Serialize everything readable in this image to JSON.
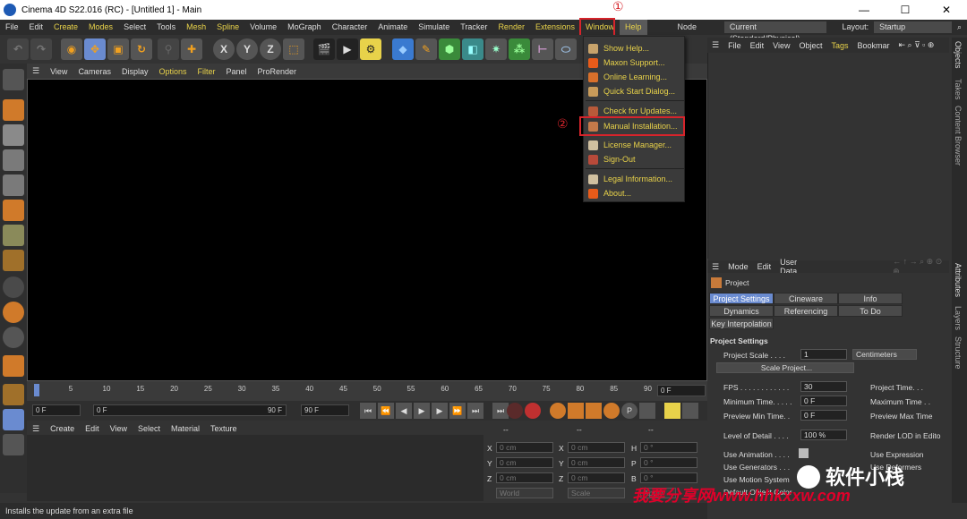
{
  "window": {
    "title": "Cinema 4D S22.016 (RC) - [Untitled 1] - Main",
    "minimize": "—",
    "maximize": "☐",
    "close": "✕"
  },
  "menubar": {
    "items": [
      "File",
      "Edit",
      "Create",
      "Modes",
      "Select",
      "Tools",
      "Mesh",
      "Spline",
      "Volume",
      "MoGraph",
      "Character",
      "Animate",
      "Simulate",
      "Tracker",
      "Render",
      "Extensions",
      "Window"
    ],
    "help": "Help",
    "node_space_label": "Node Space:",
    "node_space_value": "Current (Standard/Physical)",
    "layout_label": "Layout:",
    "layout_value": "Startup"
  },
  "annotations": {
    "step1": "①",
    "step2": "②"
  },
  "help_menu": {
    "items": [
      {
        "label": "Show Help...",
        "icon": "help-book-icon",
        "color": "#c8a36b"
      },
      {
        "label": "Maxon Support...",
        "icon": "maxon-logo-icon",
        "color": "#e85b1a"
      },
      {
        "label": "Online Learning...",
        "icon": "learning-icon",
        "color": "#d9702b"
      },
      {
        "label": "Quick Start Dialog...",
        "icon": "quick-start-icon",
        "color": "#c89b5a"
      },
      {
        "label": "Check for Updates...",
        "icon": "update-icon",
        "color": "#b85a3a"
      },
      {
        "label": "Manual Installation...",
        "icon": "manual-install-icon",
        "color": "#c47a4a"
      },
      {
        "label": "License Manager...",
        "icon": "license-icon",
        "color": "#d0c0a0"
      },
      {
        "label": "Sign-Out",
        "icon": "sign-out-icon",
        "color": "#b84a3a"
      },
      {
        "label": "Legal Information...",
        "icon": "legal-icon",
        "color": "#d0c0a0"
      },
      {
        "label": "About...",
        "icon": "about-icon",
        "color": "#e85b1a"
      }
    ]
  },
  "viewport_menu": [
    "View",
    "Cameras",
    "Display",
    "Options",
    "Filter",
    "Panel",
    "ProRender"
  ],
  "timeline": {
    "ticks": [
      "0",
      "5",
      "10",
      "15",
      "20",
      "25",
      "30",
      "35",
      "40",
      "45",
      "50",
      "55",
      "60",
      "65",
      "70",
      "75",
      "80",
      "85",
      "90"
    ],
    "current_frame": "0 F",
    "start": "0 F",
    "preview_start": "0 F",
    "preview_end": "90 F",
    "end": "90 F"
  },
  "material_menu": [
    "Create",
    "Edit",
    "View",
    "Select",
    "Material",
    "Texture"
  ],
  "coordinates": {
    "header": "--",
    "header2": "--",
    "header3": "--",
    "rows": [
      {
        "a": "X",
        "av": "0 cm",
        "b": "X",
        "bv": "0 cm",
        "c": "H",
        "cv": "0 °"
      },
      {
        "a": "Y",
        "av": "0 cm",
        "b": "Y",
        "bv": "0 cm",
        "c": "P",
        "cv": "0 °"
      },
      {
        "a": "Z",
        "av": "0 cm",
        "b": "Z",
        "bv": "0 cm",
        "c": "B",
        "cv": "0 °"
      }
    ],
    "world": "World",
    "scale": "Scale",
    "apply": "Apply"
  },
  "status": "Installs the update from an extra file",
  "object_menu": {
    "items": [
      "File",
      "Edit",
      "View",
      "Object"
    ],
    "tags": "Tags",
    "bookmarks": "Bookmar"
  },
  "side_tabs": [
    "Objects",
    "Takes",
    "Content Browser",
    "Attributes",
    "Layers",
    "Structure"
  ],
  "attributes": {
    "menu": [
      "Mode",
      "Edit",
      "User Data"
    ],
    "title": "Project",
    "tabs": [
      "Project Settings",
      "Cineware",
      "Info",
      "Dynamics",
      "Referencing",
      "To Do",
      "Key Interpolation"
    ],
    "section": "Project Settings",
    "project_scale_label": "Project Scale . . . .",
    "project_scale_value": "1",
    "project_scale_unit": "Centimeters",
    "scale_button": "Scale Project...",
    "fps_label": "FPS . . . . . . . . . . . .",
    "fps_value": "30",
    "min_time_label": "Minimum Time. . . . .",
    "min_time_value": "0 F",
    "preview_min_label": "Preview Min Time. .",
    "preview_min_value": "0 F",
    "lod_label": "Level of Detail . . . .",
    "lod_value": "100 %",
    "use_anim_label": "Use Animation . . . .",
    "use_gen_label": "Use Generators . . .",
    "use_motion_label": "Use Motion System",
    "default_label": "Default Object Color",
    "right_project_time": "Project Time. . .",
    "right_max_time": "Maximum Time . .",
    "right_preview_max": "Preview Max Time",
    "right_render_lod": "Render LOD in Edito",
    "right_use_expr": "Use Expression",
    "right_use_def": "Use Deformers"
  },
  "watermark": {
    "brand": "软件小栈",
    "url": "我要分享网www.hhkxxw.com"
  }
}
